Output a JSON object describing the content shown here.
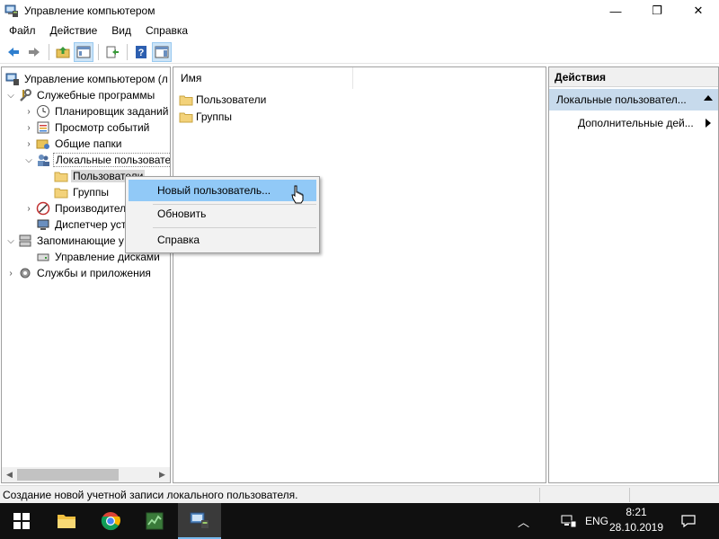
{
  "window": {
    "title": "Управление компьютером",
    "controls": {
      "minimize": "—",
      "maximize": "❐",
      "close": "✕"
    }
  },
  "menu": [
    "Файл",
    "Действие",
    "Вид",
    "Справка"
  ],
  "toolbar_icons": [
    "back-arrow-icon",
    "forward-arrow-icon",
    "up-folder-icon",
    "show-hide-tree-icon",
    "export-list-icon",
    "help-icon",
    "properties-icon"
  ],
  "tree": {
    "items": [
      {
        "label": "Управление компьютером (л",
        "icon": "computer-management-icon"
      },
      {
        "label": "Служебные программы",
        "icon": "tools-icon"
      },
      {
        "label": "Планировщик заданий",
        "icon": "clock-icon"
      },
      {
        "label": "Просмотр событий",
        "icon": "event-viewer-icon"
      },
      {
        "label": "Общие папки",
        "icon": "shared-folders-icon"
      },
      {
        "label": "Локальные пользовате",
        "icon": "users-icon"
      },
      {
        "label": "Пользователи",
        "icon": "folder-icon"
      },
      {
        "label": "Группы",
        "icon": "folder-icon"
      },
      {
        "label": "Производител",
        "icon": "performance-icon"
      },
      {
        "label": "Диспетчер уст",
        "icon": "device-manager-icon"
      },
      {
        "label": "Запоминающие у",
        "icon": "storage-icon"
      },
      {
        "label": "Управление дисками",
        "icon": "disk-management-icon"
      },
      {
        "label": "Службы и приложения",
        "icon": "services-icon"
      }
    ]
  },
  "list": {
    "column": "Имя",
    "items": [
      "Пользователи",
      "Группы"
    ]
  },
  "actions": {
    "header": "Действия",
    "section": "Локальные пользовател...",
    "more": "Дополнительные дей..."
  },
  "context_menu": {
    "items": [
      "Новый пользователь...",
      "Обновить",
      "Справка"
    ],
    "highlighted": "Новый пользователь..."
  },
  "status": {
    "text": "Создание новой учетной записи локального пользователя."
  },
  "taskbar": {
    "apps": [
      "start-icon",
      "file-explorer-icon",
      "chrome-icon",
      "task-manager-icon",
      "computer-management-icon"
    ],
    "tray": {
      "language": "ENG",
      "time": "8:21",
      "date": "28.10.2019"
    }
  },
  "colors": {
    "selection": "#91c9f7",
    "actions_section": "#c7daec",
    "taskbar": "#101010"
  }
}
